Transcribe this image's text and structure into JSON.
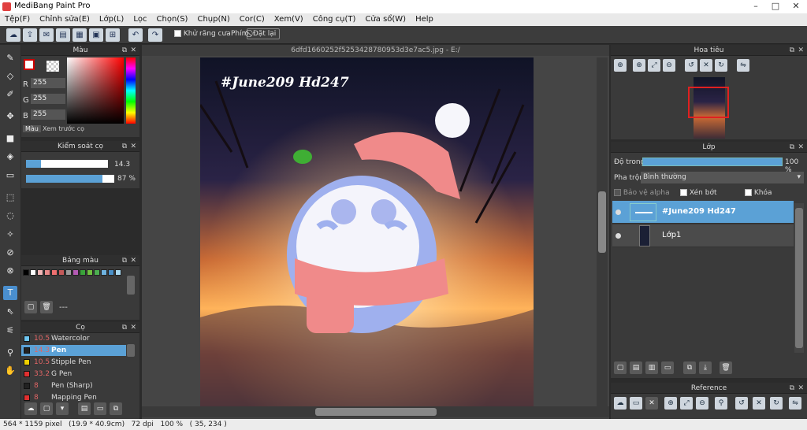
{
  "app": {
    "title": "MediBang Paint Pro"
  },
  "window_controls": [
    "–",
    "□",
    "✕"
  ],
  "menu": [
    "Tệp(F)",
    "Chỉnh sửa(E)",
    "Lớp(L)",
    "Lọc",
    "Chọn(S)",
    "Chụp(N)",
    "Cor(C)",
    "Xem(V)",
    "Công cụ(T)",
    "Cửa sổ(W)",
    "Help"
  ],
  "toolbar": {
    "antialias_label": "Khử răng cưa",
    "hotkey_label": "Phím",
    "reset_label": "Đặt lại"
  },
  "color_panel": {
    "title": "Màu",
    "r_label": "R",
    "g_label": "G",
    "b_label": "B",
    "r": "255",
    "g": "255",
    "b": "255",
    "tab_color": "Màu",
    "tab_preview": "Xem trước cọ"
  },
  "brush_control": {
    "title": "Kiểm soát cọ",
    "size": "14.3",
    "opacity": "87 %",
    "size_fraction": 0.18,
    "opacity_fraction": 0.87
  },
  "palette": {
    "title": "Bảng màu",
    "extra": "---",
    "colors": [
      "#000000",
      "#ffffff",
      "#f2b7b7",
      "#e88a8a",
      "#ee7070",
      "#c45a5a",
      "#9a9a9a",
      "#b45ab4",
      "#3aa33a",
      "#70c040",
      "#4caf50",
      "#6fb3e0",
      "#4a90c8",
      "#a8d8f0"
    ]
  },
  "brush_panel": {
    "title": "Cọ",
    "items": [
      {
        "size": "10.5",
        "name": "Watercolor",
        "color": "#6ec6f0"
      },
      {
        "size": "14.3",
        "name": "Pen",
        "color": "#222222"
      },
      {
        "size": "10.5",
        "name": "Stipple Pen",
        "color": "#f0d000"
      },
      {
        "size": "33.2",
        "name": "G Pen",
        "color": "#e03030"
      },
      {
        "size": "8",
        "name": "Pen (Sharp)",
        "color": "#222222"
      },
      {
        "size": "8",
        "name": "Mapping Pen",
        "color": "#e03030"
      }
    ]
  },
  "document": {
    "tab_title": "6dfd1660252f5253428780953d3e7ac5.jpg - E:/",
    "artwork_text": "#June209 Hd247"
  },
  "navigator": {
    "title": "Hoa tiêu"
  },
  "layers_panel": {
    "title": "Lớp",
    "opacity_label": "Độ trong",
    "opacity_value": "100 %",
    "blend_label": "Pha trộn",
    "blend_value": "Bình thường",
    "alpha_protect": "Bảo vệ alpha",
    "clipping": "Xén bớt",
    "lock": "Khóa",
    "layers": [
      {
        "name": "#June209 Hd247",
        "selected": true
      },
      {
        "name": "Lớp1",
        "selected": false
      }
    ]
  },
  "reference": {
    "title": "Reference"
  },
  "status": {
    "text": "564 * 1159 pixel   (19.9 * 40.9cm)   72 dpi   100 %   ( 35, 234 )"
  }
}
